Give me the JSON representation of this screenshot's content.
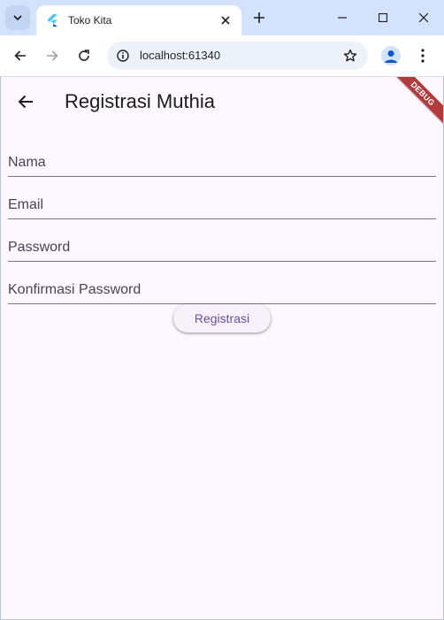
{
  "browser": {
    "tab_title": "Toko Kita",
    "url": "localhost:61340"
  },
  "app": {
    "title": "Registrasi Muthia",
    "debug_banner": "DEBUG",
    "fields": [
      {
        "placeholder": "Nama"
      },
      {
        "placeholder": "Email"
      },
      {
        "placeholder": "Password"
      },
      {
        "placeholder": "Konfirmasi Password"
      }
    ],
    "submit_label": "Registrasi"
  },
  "colors": {
    "background": "#fdf7ff",
    "accent": "#6750a4",
    "tabstrip": "#d3e3fd",
    "debug": "#b13a3a"
  },
  "icons": [
    "tab-search-icon",
    "flutter-logo-icon",
    "close-icon",
    "plus-icon",
    "minimize-icon",
    "maximize-icon",
    "window-close-icon",
    "back-arrow-icon",
    "forward-arrow-icon",
    "reload-icon",
    "site-info-icon",
    "star-icon",
    "profile-icon",
    "more-vert-icon",
    "app-back-arrow-icon"
  ]
}
